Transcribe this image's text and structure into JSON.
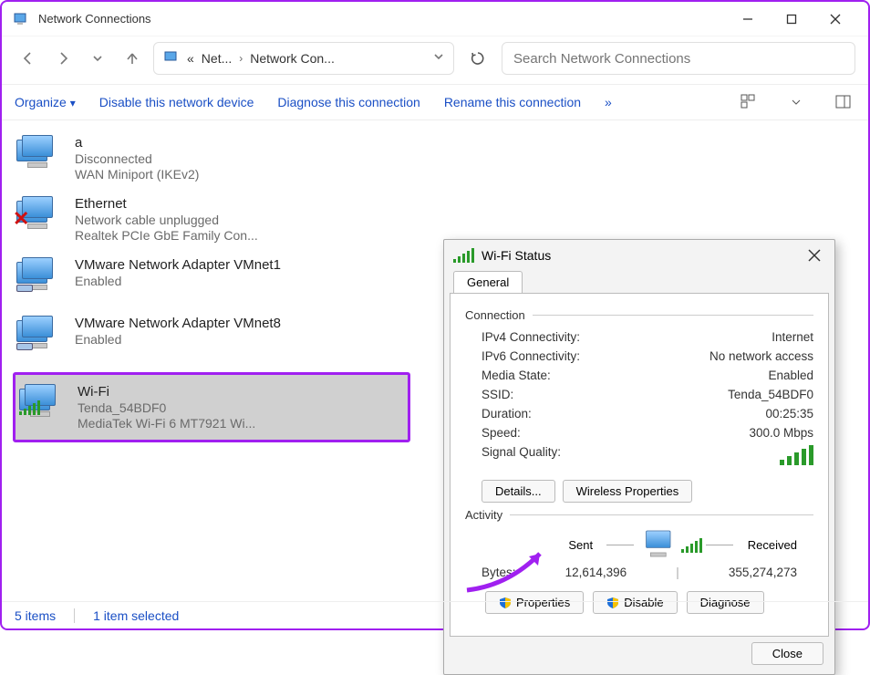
{
  "window": {
    "title": "Network Connections"
  },
  "breadcrumb": {
    "p1": "Net...",
    "p2": "Network Con...",
    "prefix": "«"
  },
  "search": {
    "placeholder": "Search Network Connections"
  },
  "commands": {
    "organize": "Organize",
    "disable": "Disable this network device",
    "diagnose": "Diagnose this connection",
    "rename": "Rename this connection",
    "overflow": "»"
  },
  "adapters": [
    {
      "name": "a",
      "sub1": "Disconnected",
      "sub2": "WAN Miniport (IKEv2)",
      "icon": "wan"
    },
    {
      "name": "Ethernet",
      "sub1": "Network cable unplugged",
      "sub2": "Realtek PCIe GbE Family Con...",
      "icon": "eth-x"
    },
    {
      "name": "VMware Network Adapter VMnet1",
      "sub1": "Enabled",
      "sub2": "",
      "icon": "vm"
    },
    {
      "name": "VMware Network Adapter VMnet8",
      "sub1": "Enabled",
      "sub2": "",
      "icon": "vm"
    },
    {
      "name": "Wi-Fi",
      "sub1": "Tenda_54BDF0",
      "sub2": "MediaTek Wi-Fi 6 MT7921 Wi...",
      "icon": "wifi",
      "selected": true
    }
  ],
  "status": {
    "count": "5 items",
    "selected": "1 item selected"
  },
  "dialog": {
    "title": "Wi-Fi Status",
    "tab": "General",
    "group_connection": "Connection",
    "rows": {
      "ipv4_k": "IPv4 Connectivity:",
      "ipv4_v": "Internet",
      "ipv6_k": "IPv6 Connectivity:",
      "ipv6_v": "No network access",
      "media_k": "Media State:",
      "media_v": "Enabled",
      "ssid_k": "SSID:",
      "ssid_v": "Tenda_54BDF0",
      "dur_k": "Duration:",
      "dur_v": "00:25:35",
      "speed_k": "Speed:",
      "speed_v": "300.0 Mbps",
      "sigq_k": "Signal Quality:"
    },
    "details_btn": "Details...",
    "wprops_btn": "Wireless Properties",
    "group_activity": "Activity",
    "activity": {
      "sent": "Sent",
      "received": "Received",
      "bytes_k": "Bytes:",
      "sent_v": "12,614,396",
      "recv_v": "355,274,273"
    },
    "props_btn": "Properties",
    "disable_btn": "Disable",
    "diagnose_btn": "Diagnose",
    "close_btn": "Close"
  }
}
